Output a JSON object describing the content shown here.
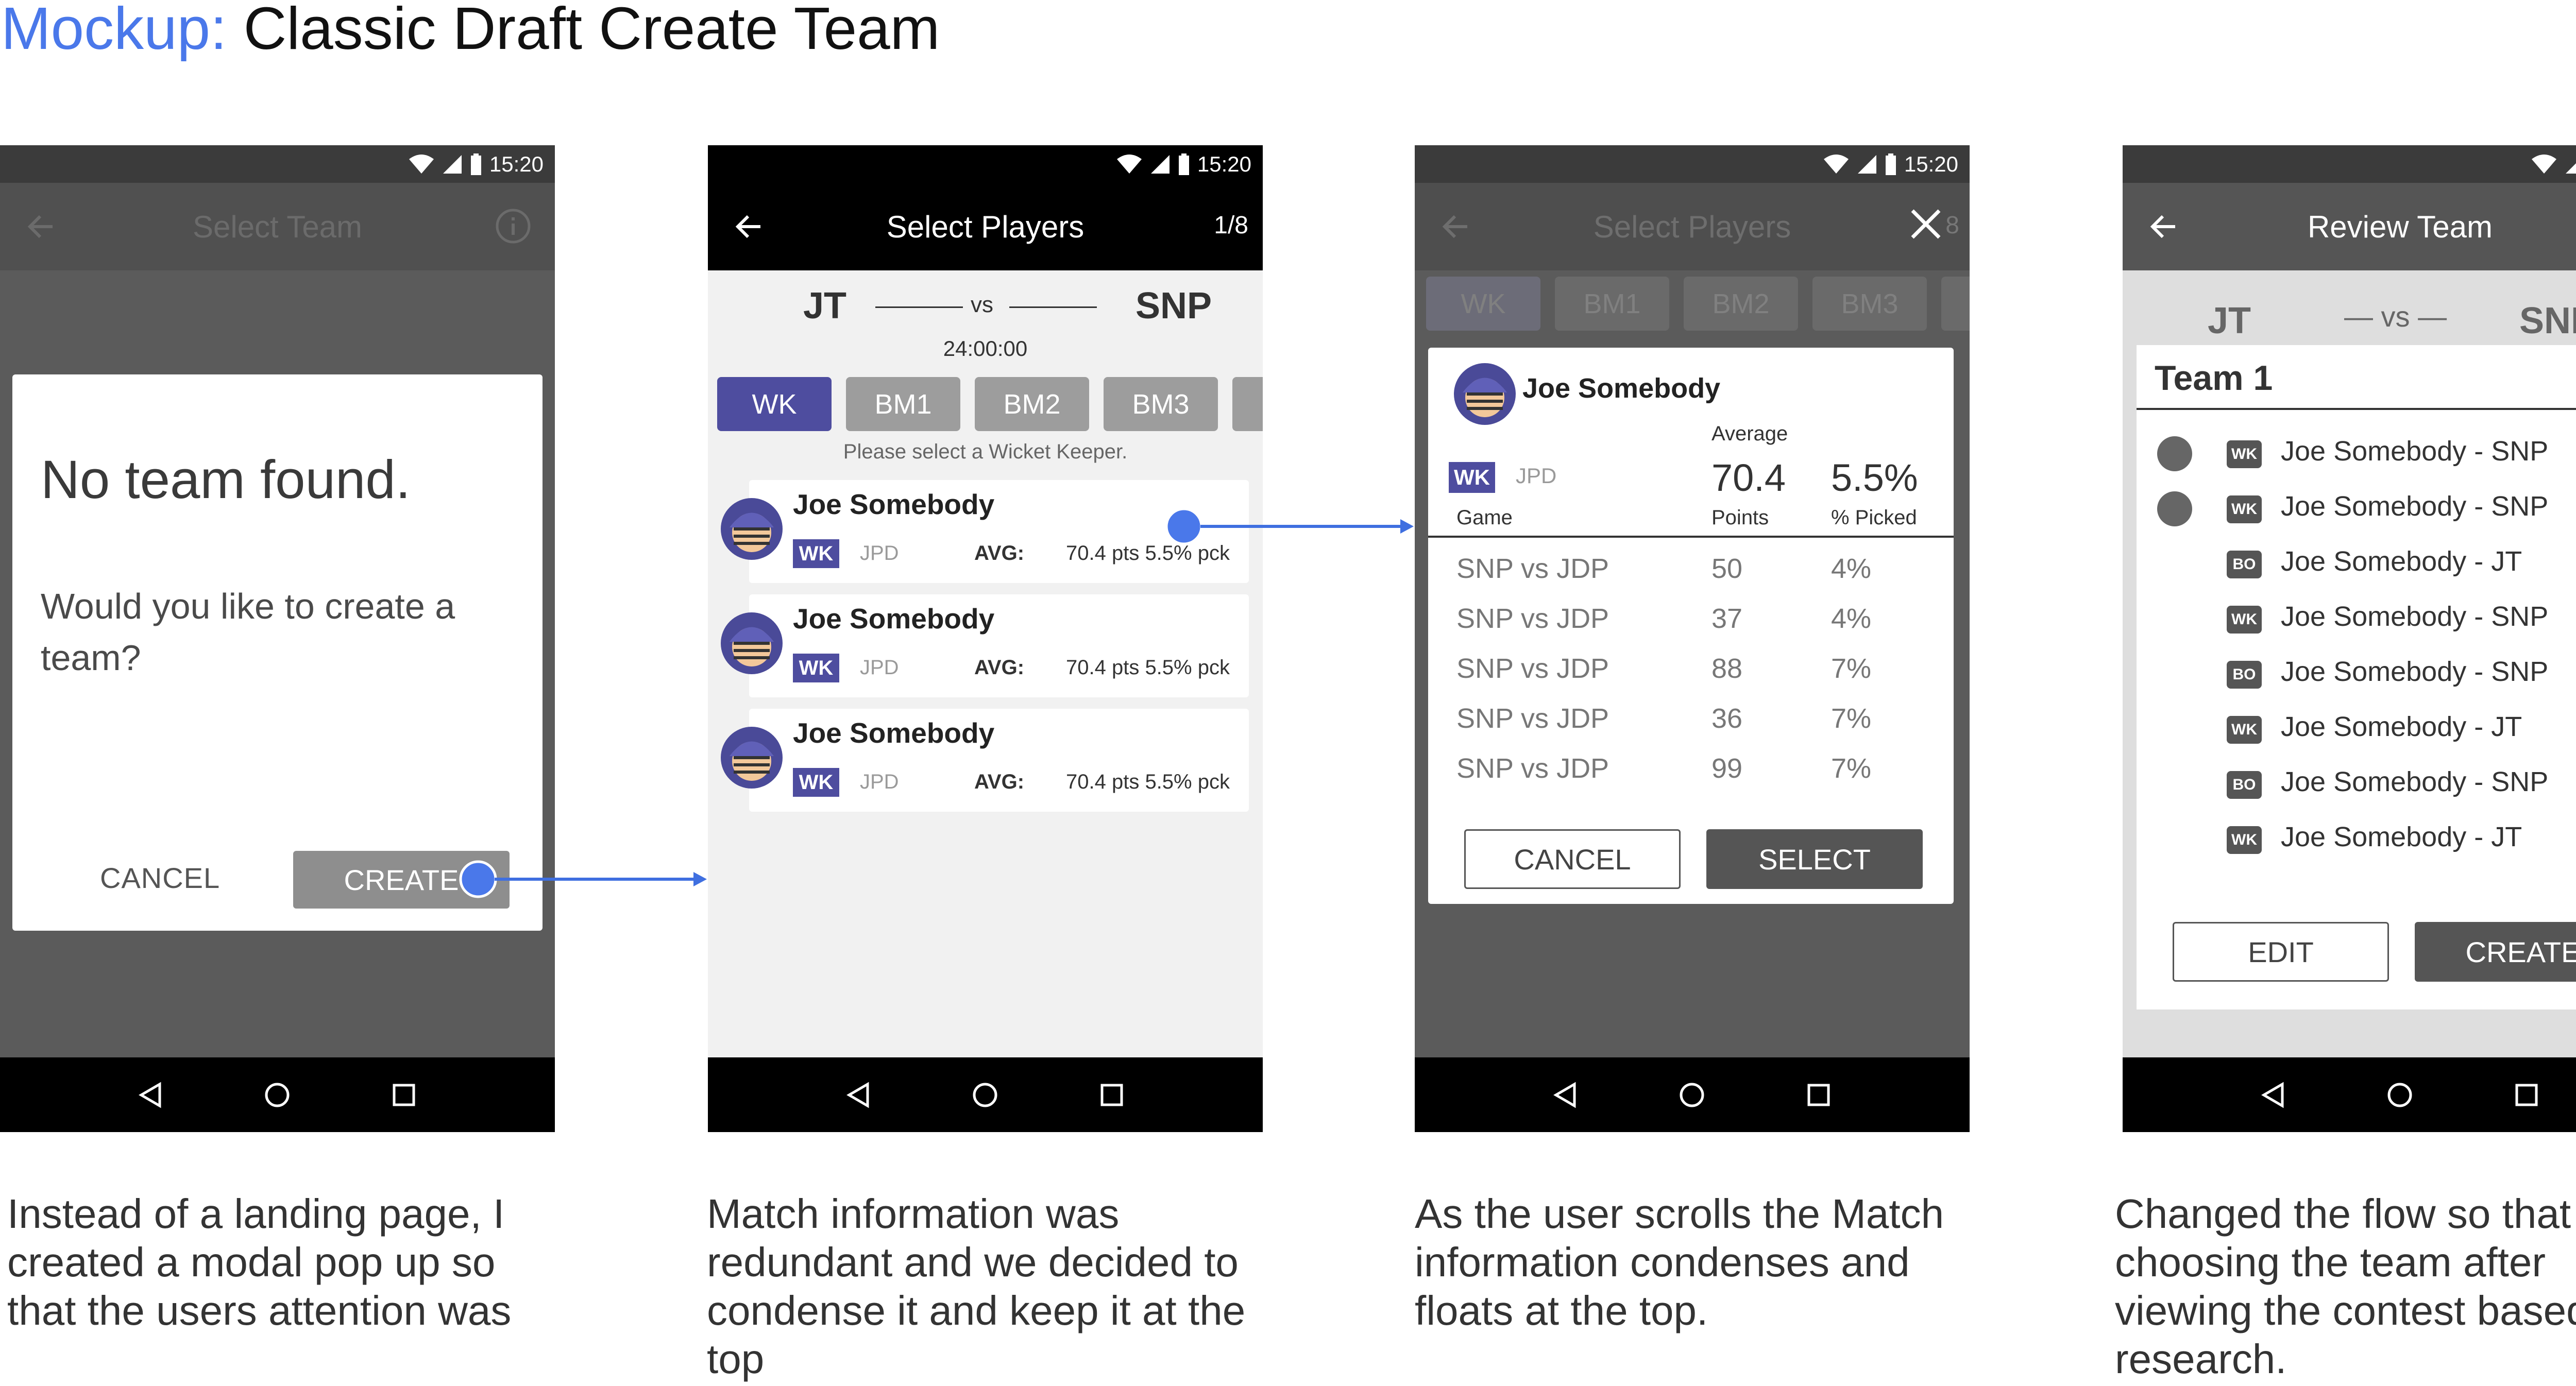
{
  "page": {
    "title_prefix": "Mockup:",
    "title_main": "Classic Draft Create Team"
  },
  "status": {
    "time": "15:20"
  },
  "screen1": {
    "app_title": "Select Team",
    "modal_heading": "No team found.",
    "modal_body": "Would you like to create a team?",
    "cancel_label": "CANCEL",
    "create_label": "CREATE"
  },
  "screen2": {
    "app_title": "Select Players",
    "pager": "1/8",
    "team_left": "JT",
    "vs": "vs",
    "team_right": "SNP",
    "timer": "24:00:00",
    "tabs": [
      "WK",
      "BM1",
      "BM2",
      "BM3"
    ],
    "hint": "Please select a Wicket Keeper.",
    "players": [
      {
        "name": "Joe Somebody",
        "role": "WK",
        "team": "JPD",
        "avg_label": "AVG:",
        "avg_value": "70.4 pts  5.5% pck"
      },
      {
        "name": "Joe Somebody",
        "role": "WK",
        "team": "JPD",
        "avg_label": "AVG:",
        "avg_value": "70.4 pts  5.5% pck"
      },
      {
        "name": "Joe Somebody",
        "role": "WK",
        "team": "JPD",
        "avg_label": "AVG:",
        "avg_value": "70.4 pts  5.5% pck"
      }
    ]
  },
  "screen3": {
    "app_title": "Select Players",
    "pager_partial": "8",
    "tabs": [
      "WK",
      "BM1",
      "BM2",
      "BM3"
    ],
    "player_name": "Joe Somebody",
    "average_label": "Average",
    "role": "WK",
    "team": "JPD",
    "avg_points": "70.4",
    "avg_picked": "5.5%",
    "col_game": "Game",
    "col_points": "Points",
    "col_picked": "% Picked",
    "rows": [
      {
        "game": "SNP vs JDP",
        "points": "50",
        "picked": "4%"
      },
      {
        "game": "SNP vs JDP",
        "points": "37",
        "picked": "4%"
      },
      {
        "game": "SNP vs JDP",
        "points": "88",
        "picked": "7%"
      },
      {
        "game": "SNP vs JDP",
        "points": "36",
        "picked": "7%"
      },
      {
        "game": "SNP vs JDP",
        "points": "99",
        "picked": "7%"
      }
    ],
    "cancel_label": "CANCEL",
    "select_label": "SELECT"
  },
  "screen4": {
    "app_title": "Review Team",
    "team_left": "JT",
    "vs": "— vs —",
    "team_right": "SNP",
    "team_name": "Team 1",
    "players": [
      {
        "role": "WK",
        "name": "Joe Somebody - SNP",
        "dot": true
      },
      {
        "role": "WK",
        "name": "Joe Somebody - SNP",
        "dot": true
      },
      {
        "role": "BO",
        "name": "Joe Somebody - JT",
        "dot": false
      },
      {
        "role": "WK",
        "name": "Joe Somebody - SNP",
        "dot": false
      },
      {
        "role": "BO",
        "name": "Joe Somebody - SNP",
        "dot": false
      },
      {
        "role": "WK",
        "name": "Joe Somebody - JT",
        "dot": false
      },
      {
        "role": "BO",
        "name": "Joe Somebody - SNP",
        "dot": false
      },
      {
        "role": "WK",
        "name": "Joe Somebody - JT",
        "dot": false
      }
    ],
    "edit_label": "EDIT",
    "create_label": "CREATE"
  },
  "captions": [
    "Instead of a landing page, I created a modal pop up so that the users attention was",
    "Match information was redundant and we decided to condense it and keep it at the top",
    "As the user scrolls the Match information condenses and floats at the top.",
    "Changed the flow so that choosing the team after viewing the contest based off research."
  ],
  "colors": {
    "accent_blue": "#4a78ea",
    "role_purple": "#4e4d9f",
    "connector": "#3f6fe0"
  },
  "icons": {
    "status": [
      "wifi-icon",
      "cellular-icon",
      "battery-icon"
    ],
    "nav": [
      "back-triangle-icon",
      "home-circle-icon",
      "recents-square-icon"
    ]
  }
}
